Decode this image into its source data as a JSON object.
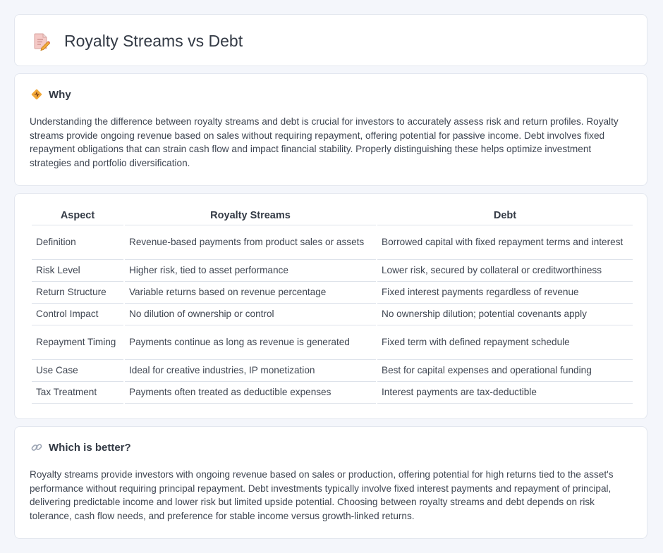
{
  "page": {
    "title": "Royalty Streams vs Debt",
    "title_icon": "document-pencil-icon"
  },
  "why": {
    "icon": "diamond-signal-icon",
    "heading": "Why",
    "text": "Understanding the difference between royalty streams and debt is crucial for investors to accurately assess risk and return profiles. Royalty streams provide ongoing revenue based on sales without requiring repayment, offering potential for passive income. Debt involves fixed repayment obligations that can strain cash flow and impact financial stability. Properly distinguishing these helps optimize investment strategies and portfolio diversification."
  },
  "comparison": {
    "headers": [
      "Aspect",
      "Royalty Streams",
      "Debt"
    ],
    "rows": [
      {
        "aspect": "Definition",
        "royalty": "Revenue-based payments from product sales or assets",
        "debt": "Borrowed capital with fixed repayment terms and interest"
      },
      {
        "aspect": "Risk Level",
        "royalty": "Higher risk, tied to asset performance",
        "debt": "Lower risk, secured by collateral or creditworthiness"
      },
      {
        "aspect": "Return Structure",
        "royalty": "Variable returns based on revenue percentage",
        "debt": "Fixed interest payments regardless of revenue"
      },
      {
        "aspect": "Control Impact",
        "royalty": "No dilution of ownership or control",
        "debt": "No ownership dilution; potential covenants apply"
      },
      {
        "aspect": "Repayment Timing",
        "royalty": "Payments continue as long as revenue is generated",
        "debt": "Fixed term with defined repayment schedule"
      },
      {
        "aspect": "Use Case",
        "royalty": "Ideal for creative industries, IP monetization",
        "debt": "Best for capital expenses and operational funding"
      },
      {
        "aspect": "Tax Treatment",
        "royalty": "Payments often treated as deductible expenses",
        "debt": "Interest payments are tax-deductible"
      }
    ]
  },
  "better": {
    "icon": "link-icon",
    "heading": "Which is better?",
    "text": "Royalty streams provide investors with ongoing revenue based on sales or production, offering potential for high returns tied to the asset's performance without requiring principal repayment. Debt investments typically involve fixed interest payments and repayment of principal, delivering predictable income and lower risk but limited upside potential. Choosing between royalty streams and debt depends on risk tolerance, cash flow needs, and preference for stable income versus growth-linked returns."
  },
  "colors": {
    "background": "#f4f6fb",
    "card": "#ffffff",
    "border": "#e3e7ef",
    "icon_accent": "#f2a93b",
    "icon_pink": "#e8707a"
  }
}
